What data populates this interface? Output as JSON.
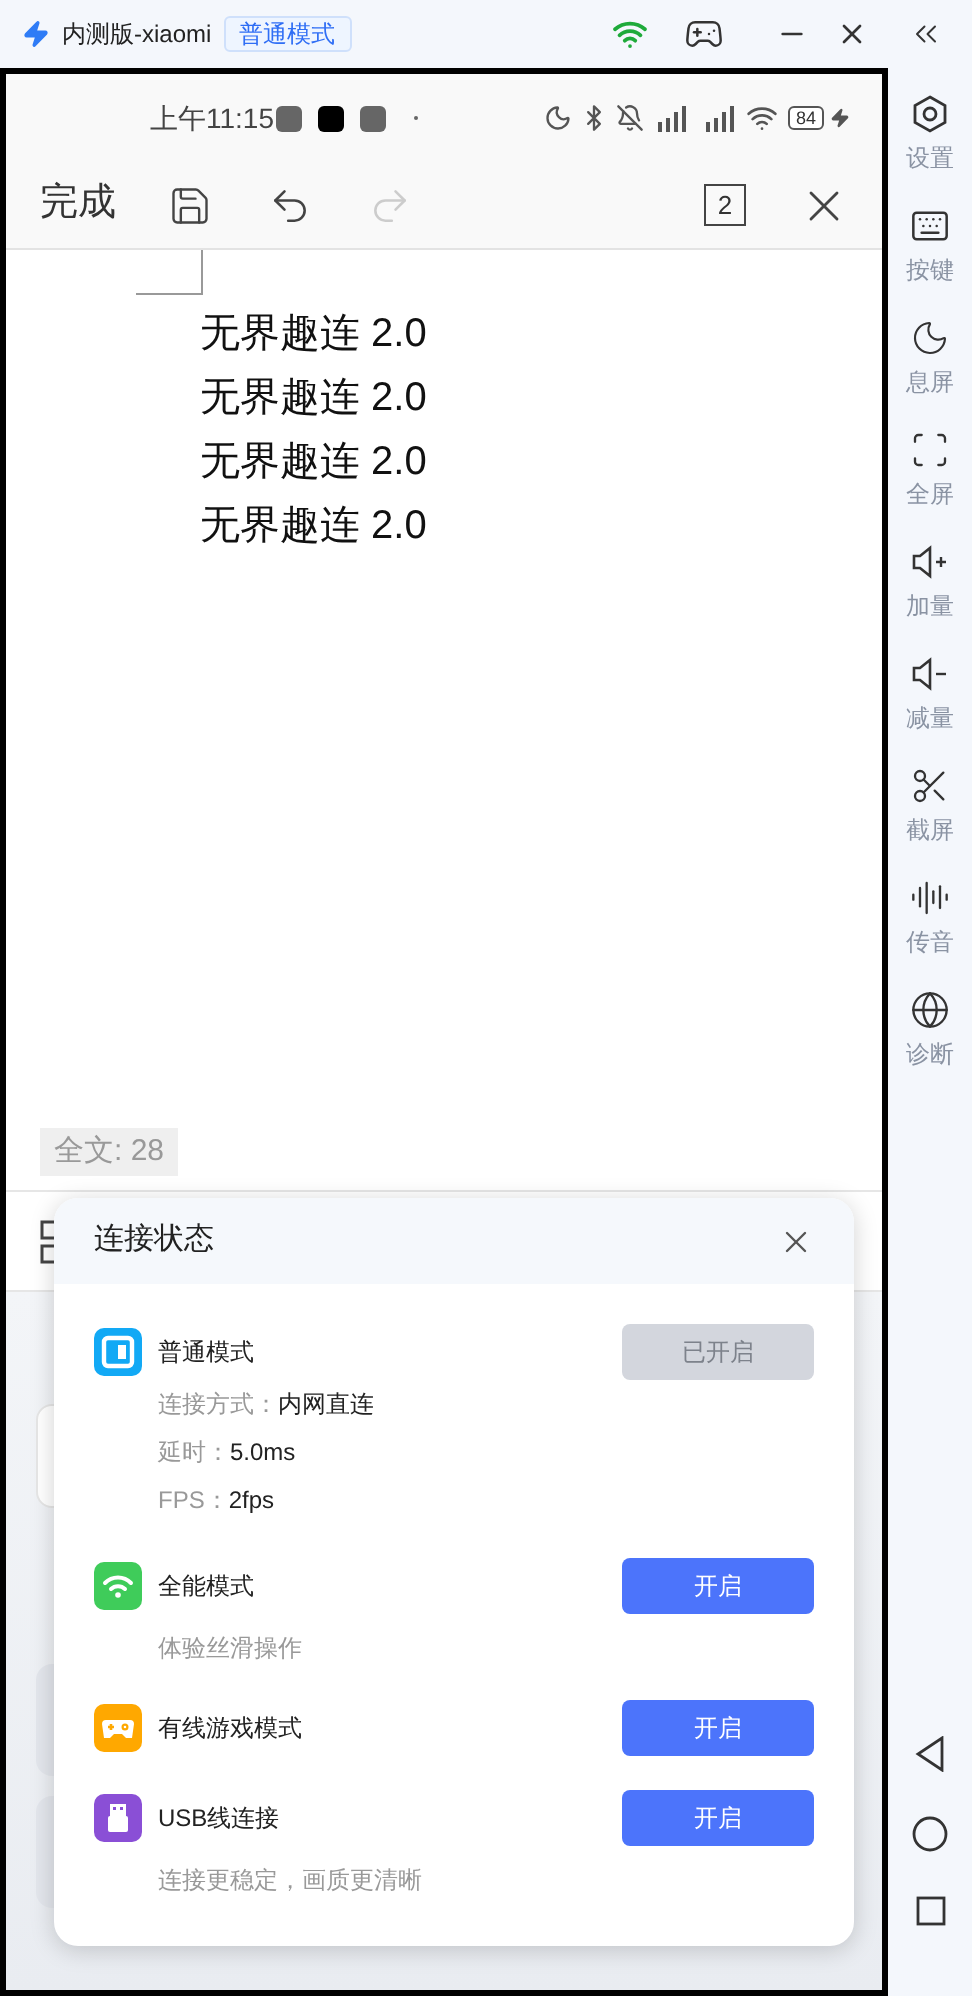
{
  "title_bar": {
    "app_name": "内测版-xiaomi",
    "mode_badge": "普通模式"
  },
  "phone": {
    "status_bar": {
      "time": "上午11:15",
      "battery": "84"
    },
    "toolbar": {
      "done": "完成",
      "undo": {
        "disabled": false
      },
      "redo": {
        "disabled": true
      },
      "tab_count": "2"
    },
    "document_lines": [
      "无界趣连 2.0",
      "无界趣连 2.0",
      "无界趣连 2.0",
      "无界趣连 2.0"
    ],
    "word_count": "全文: 28"
  },
  "dialog": {
    "title": "连接状态",
    "modes": [
      {
        "kind": "normal",
        "name": "普通模式",
        "color": "#12a9f5",
        "details": [
          {
            "label": "连接方式：",
            "value": "内网直连"
          },
          {
            "label": "延时：",
            "value": "5.0ms"
          },
          {
            "label": "FPS：",
            "value": "2fps"
          }
        ],
        "button": {
          "label": "已开启",
          "disabled": true
        }
      },
      {
        "kind": "wifi",
        "name": "全能模式",
        "color": "#3fcc5a",
        "description": "体验丝滑操作",
        "button": {
          "label": "开启",
          "disabled": false
        }
      },
      {
        "kind": "game",
        "name": "有线游戏模式",
        "color": "#ffa800",
        "button": {
          "label": "开启",
          "disabled": false
        }
      },
      {
        "kind": "usb",
        "name": "USB线连接",
        "color": "#8a4fd6",
        "description": "连接更稳定，画质更清晰",
        "button": {
          "label": "开启",
          "disabled": false
        }
      }
    ]
  },
  "sidebar": {
    "items": [
      {
        "kind": "settings",
        "label": "设置"
      },
      {
        "kind": "keys",
        "label": "按键"
      },
      {
        "kind": "screen_off",
        "label": "息屏"
      },
      {
        "kind": "fullscreen",
        "label": "全屏"
      },
      {
        "kind": "volume_up",
        "label": "加量"
      },
      {
        "kind": "volume_down",
        "label": "减量"
      },
      {
        "kind": "screenshot",
        "label": "截屏"
      },
      {
        "kind": "audio",
        "label": "传音"
      },
      {
        "kind": "diagnose",
        "label": "诊断"
      }
    ]
  }
}
